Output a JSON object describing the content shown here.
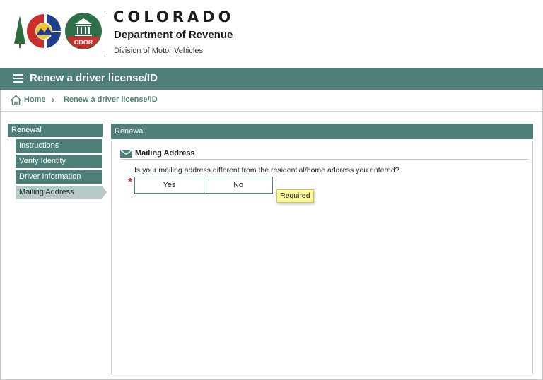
{
  "header": {
    "state": "COLORADO",
    "department": "Department of Revenue",
    "division": "Division of Motor Vehicles",
    "cdor_logo_text": "CDOR"
  },
  "titlebar": {
    "title": "Renew a driver license/ID"
  },
  "breadcrumb": {
    "home": "Home",
    "separator": "›",
    "current": "Renew a driver license/ID"
  },
  "sidebar": {
    "heading": "Renewal",
    "items": [
      {
        "label": "Instructions"
      },
      {
        "label": "Verify Identity"
      },
      {
        "label": "Driver Information"
      },
      {
        "label": "Mailing Address"
      }
    ]
  },
  "panel": {
    "heading": "Renewal",
    "section_title": "Mailing Address",
    "question": "Is your mailing address different from the residential/home address you entered?",
    "required_marker": "*",
    "options": [
      {
        "label": "Yes"
      },
      {
        "label": "No"
      }
    ],
    "tooltip": "Required"
  },
  "colors": {
    "brand_teal": "#4e7f79",
    "active_item": "#b7c9c6",
    "tooltip_bg": "#fffa9e",
    "required": "#dd2222"
  }
}
